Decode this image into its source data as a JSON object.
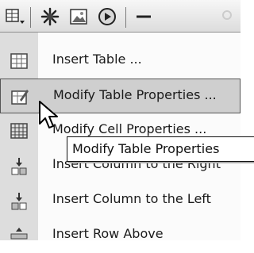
{
  "toolbar": {
    "icons": [
      "table-dropdown-icon",
      "spark-icon",
      "image-icon",
      "play-icon",
      "minus-icon"
    ]
  },
  "menu": {
    "items": [
      {
        "label": "Insert Table ...",
        "icon": "table-icon"
      },
      {
        "label": "Modify Table Properties ...",
        "icon": "table-edit-icon",
        "highlighted": true
      },
      {
        "label": "Modify Cell Properties ...",
        "icon": "cell-grid-icon"
      },
      {
        "label": "Insert Column to the Right",
        "icon": "column-right-icon"
      },
      {
        "label": "Insert Column to the Left",
        "icon": "column-left-icon"
      },
      {
        "label": "Insert Row Above",
        "icon": "row-above-icon"
      }
    ]
  },
  "tooltip": {
    "text": "Modify Table Properties"
  }
}
